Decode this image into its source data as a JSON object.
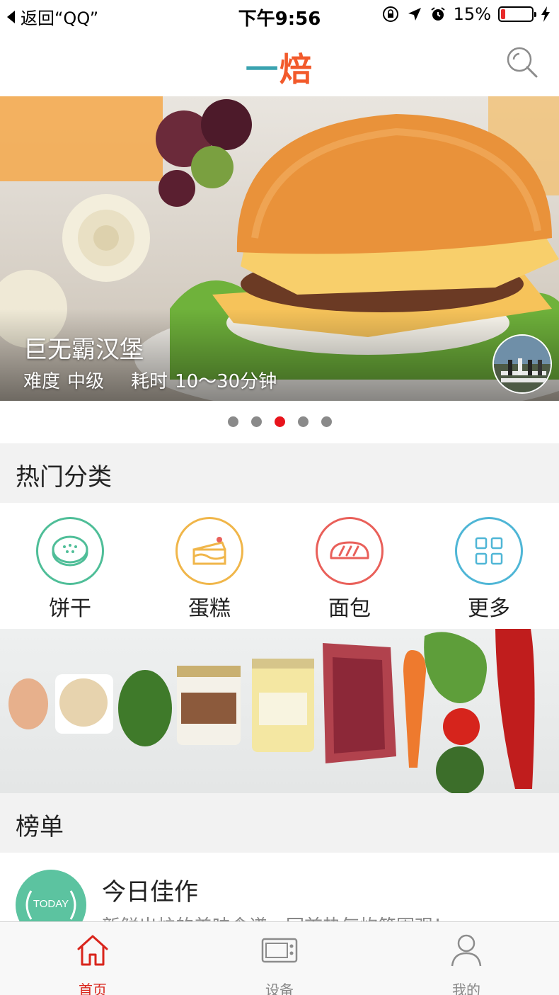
{
  "status_bar": {
    "back_label": "返回“QQ”",
    "time": "下午9:56",
    "battery_percent": "15%",
    "battery_level": 0.15
  },
  "nav": {
    "logo_part1": "一",
    "logo_part2": "焙"
  },
  "hero": {
    "title": "巨无霸汉堡",
    "difficulty_label": "难度",
    "difficulty_value": "中级",
    "time_label": "耗时",
    "time_value": "10～30分钟",
    "page_count": 5,
    "active_page": 3
  },
  "hot_categories": {
    "header": "热门分类",
    "items": [
      {
        "label": "饼干",
        "icon": "cookie-icon",
        "color": "#4fbe98"
      },
      {
        "label": "蛋糕",
        "icon": "cake-icon",
        "color": "#f0b64a"
      },
      {
        "label": "面包",
        "icon": "bread-icon",
        "color": "#e9605a"
      },
      {
        "label": "更多",
        "icon": "grid-icon",
        "color": "#4fb6d6"
      }
    ]
  },
  "ranking": {
    "header": "榜单",
    "items": [
      {
        "badge": "TODAY",
        "title": "今日佳作",
        "desc": "新鲜出炉的美味食谱，回首热气炊笼围观！"
      }
    ]
  },
  "tabbar": {
    "items": [
      {
        "label": "首页",
        "icon": "home-icon",
        "active": true
      },
      {
        "label": "设备",
        "icon": "oven-icon",
        "active": false
      },
      {
        "label": "我的",
        "icon": "user-icon",
        "active": false
      }
    ]
  },
  "colors": {
    "accent_red": "#d9251c",
    "dot_active": "#e8141c",
    "logo_teal": "#3aa3b0",
    "logo_orange": "#f25a2b"
  }
}
